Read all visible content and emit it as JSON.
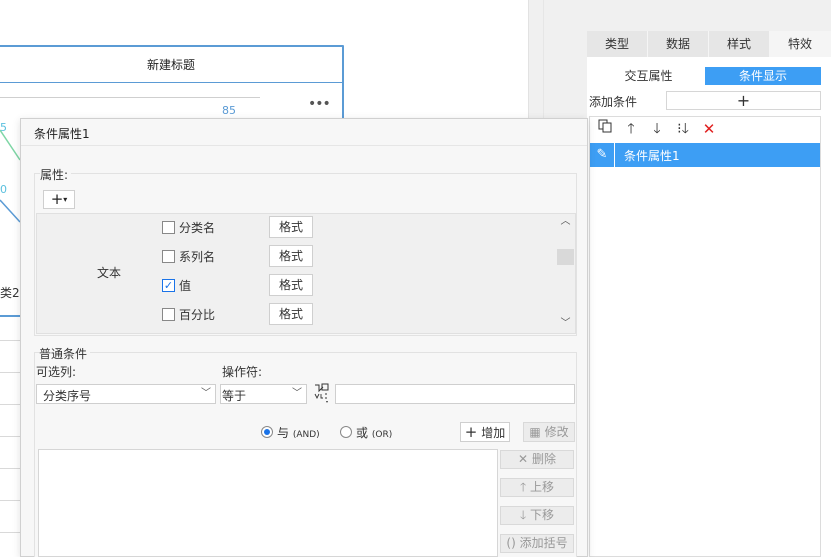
{
  "canvas": {
    "chart_title": "新建标题",
    "chart_value_label": "85",
    "more_icon": "more-icon",
    "partial_label_1": "5",
    "partial_label_2": "0",
    "partial_label_3": "类2"
  },
  "right_panel": {
    "tabs": [
      {
        "label": "类型",
        "active": false
      },
      {
        "label": "数据",
        "active": false
      },
      {
        "label": "样式",
        "active": false
      },
      {
        "label": "特效",
        "active": true
      }
    ],
    "subtabs": [
      {
        "label": "交互属性",
        "active": false
      },
      {
        "label": "条件显示",
        "active": true
      }
    ],
    "add_condition_label": "添加条件",
    "add_condition_icon": "plus-icon",
    "toolbar_icons": [
      "copy-icon",
      "arrow-up-icon",
      "arrow-down-icon",
      "move-bottom-icon",
      "delete-icon"
    ],
    "list_items": [
      {
        "label": "条件属性1",
        "selected": true,
        "icon": "pencil-icon"
      }
    ],
    "accent_color": "#3d9ef4"
  },
  "dialog": {
    "title": "条件属性1",
    "properties_label": "属性:",
    "add_property_icon": "plus-dropdown-icon",
    "text_group_label": "文本",
    "checkboxes": [
      {
        "label": "分类名",
        "checked": false,
        "format_label": "格式"
      },
      {
        "label": "系列名",
        "checked": false,
        "format_label": "格式"
      },
      {
        "label": "值",
        "checked": true,
        "format_label": "格式"
      },
      {
        "label": "百分比",
        "checked": false,
        "format_label": "格式"
      }
    ],
    "normal_condition": {
      "group_label": "普通条件",
      "column_label": "可选列:",
      "operator_label": "操作符:",
      "column_value": "分类序号",
      "operator_value": "等于",
      "value_input": "",
      "formula_icon": "abc-formula-icon",
      "and_label": "与",
      "and_suffix": "(AND)",
      "or_label": "或",
      "or_suffix": "(OR)",
      "logic_selected": "and",
      "add_label": "增加",
      "edit_label": "修改",
      "delete_label": "删除",
      "move_up_label": "上移",
      "move_down_label": "下移",
      "add_bracket_label": "添加括号"
    }
  }
}
